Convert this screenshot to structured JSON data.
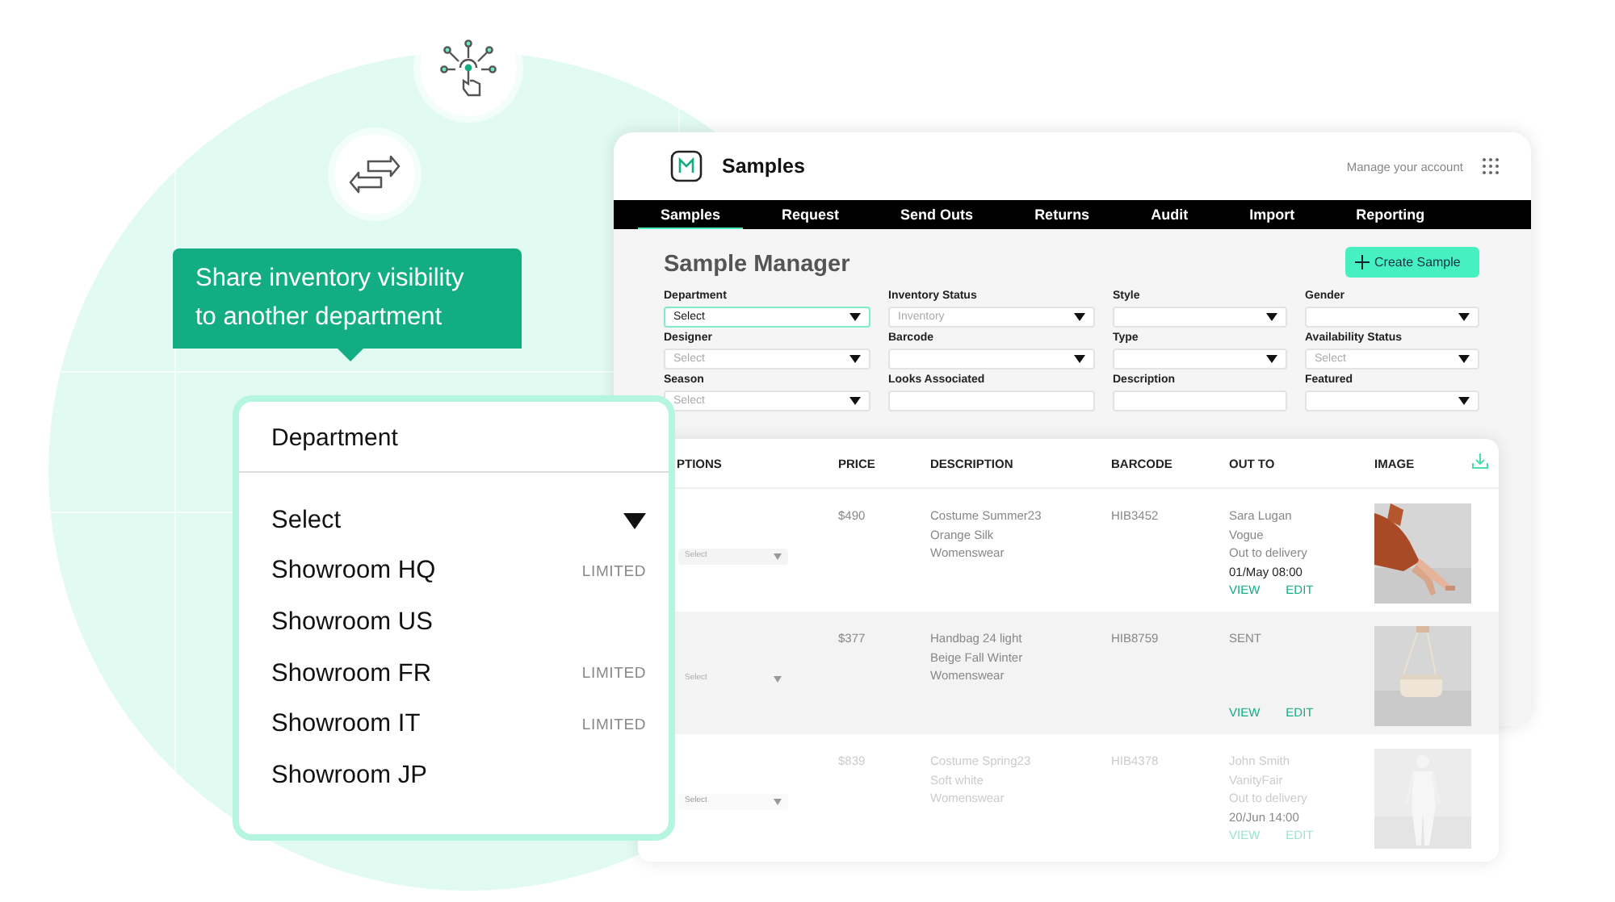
{
  "hero": {
    "callout": "Share inventory visibility\nto another department"
  },
  "app": {
    "title": "Samples",
    "account_link": "Manage your account",
    "tabs": [
      {
        "label": "Samples",
        "selected": true
      },
      {
        "label": "Request",
        "selected": false
      },
      {
        "label": "Send Outs",
        "selected": false
      },
      {
        "label": "Returns",
        "selected": false
      },
      {
        "label": "Audit",
        "selected": false
      },
      {
        "label": "Import",
        "selected": false
      },
      {
        "label": "Reporting",
        "selected": false
      }
    ],
    "heading": "Sample Manager",
    "create_button": "Create Sample",
    "filters": [
      {
        "label": "Department",
        "kind": "select",
        "value": "Select",
        "focused": true
      },
      {
        "label": "Inventory Status",
        "kind": "select",
        "placeholder": "Inventory",
        "focused": false
      },
      {
        "label": "Style",
        "kind": "select",
        "focused": false
      },
      {
        "label": "Gender",
        "kind": "select",
        "focused": false
      },
      {
        "label": "Designer",
        "kind": "select",
        "placeholder": "Select",
        "focused": false
      },
      {
        "label": "Barcode",
        "kind": "select",
        "focused": false
      },
      {
        "label": "Type",
        "kind": "select",
        "focused": false
      },
      {
        "label": "Availability Status",
        "kind": "select",
        "placeholder": "Select",
        "focused": false
      },
      {
        "label": "Season",
        "kind": "select",
        "placeholder": "Select",
        "focused": false
      },
      {
        "label": "Looks Associated",
        "kind": "text",
        "focused": false
      },
      {
        "label": "Description",
        "kind": "text",
        "focused": false
      },
      {
        "label": "Featured",
        "kind": "select",
        "focused": false
      }
    ]
  },
  "table": {
    "columns": [
      "PTIONS",
      "PRICE",
      "DESCRIPTION",
      "BARCODE",
      "OUT TO",
      "IMAGE"
    ],
    "rows": [
      {
        "option_placeholder": "Select",
        "price": "$490",
        "description": "Costume Summer23\nOrange Silk\nWomenswear",
        "barcode": "HIB3452",
        "out_to": "Sara Lugan\nVogue\nOut to delivery",
        "date": "01/May 08:00",
        "actions": [
          "VIEW",
          "EDIT"
        ],
        "highlighted": false,
        "disabled": false
      },
      {
        "option_placeholder": "Select",
        "price": "$377",
        "description": "Handbag 24 light\nBeige Fall Winter\nWomenswear",
        "barcode": "HIB8759",
        "out_to": "SENT",
        "actions": [
          "VIEW",
          "EDIT"
        ],
        "highlighted": true,
        "disabled": false
      },
      {
        "option_placeholder": "Select",
        "price": "$839",
        "description": "Costume Spring23\nSoft white\nWomenswear",
        "barcode": "HIB4378",
        "out_to": "John Smith\nVanityFair\nOut to delivery",
        "date": "20/Jun 14:00",
        "actions": [
          "VIEW",
          "EDIT"
        ],
        "highlighted": false,
        "disabled": true
      }
    ]
  },
  "department_dropdown": {
    "title": "Department",
    "current": "Select",
    "options": [
      {
        "label": "Showroom HQ",
        "badge": "LIMITED"
      },
      {
        "label": "Showroom US"
      },
      {
        "label": "Showroom FR",
        "badge": "LIMITED"
      },
      {
        "label": "Showroom IT",
        "badge": "LIMITED"
      },
      {
        "label": "Showroom JP"
      }
    ]
  }
}
